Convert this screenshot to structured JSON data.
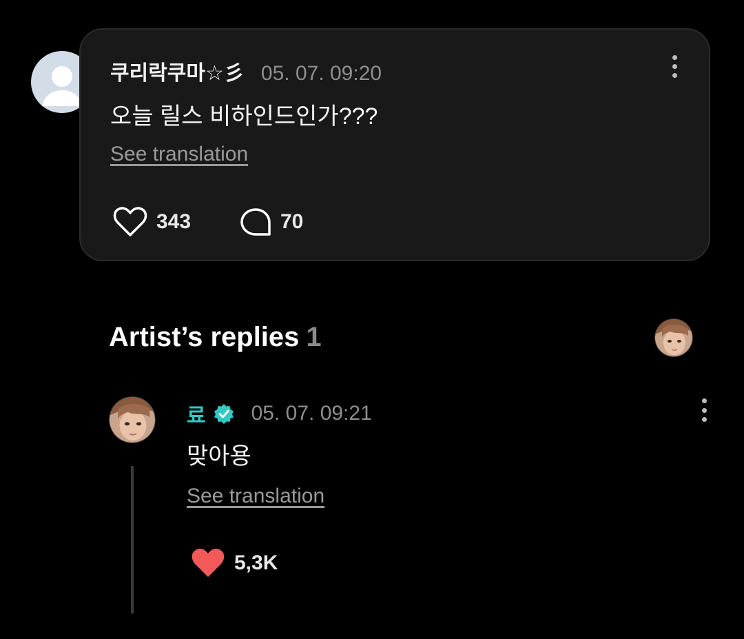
{
  "comment": {
    "author": "쿠리락쿠마☆彡",
    "timestamp": "05. 07. 09:20",
    "text": "오늘 릴스 비하인드인가???",
    "see_translation": "See translation",
    "likes": "343",
    "replies": "70",
    "avatar_color": "#d3dde8"
  },
  "artist_replies": {
    "title": "Artist’s replies",
    "count": "1",
    "reply": {
      "author": "료",
      "verified": true,
      "timestamp": "05. 07. 09:21",
      "text": "맞아용",
      "see_translation": "See translation",
      "likes": "5,3K",
      "name_color": "#31c9c4",
      "like_color": "#f25a5a"
    }
  },
  "icons": {
    "like": "heart-outline-icon",
    "reply": "speech-bubble-icon",
    "more": "kebab-menu-icon",
    "verified": "verified-badge-icon",
    "liked": "heart-filled-icon"
  }
}
